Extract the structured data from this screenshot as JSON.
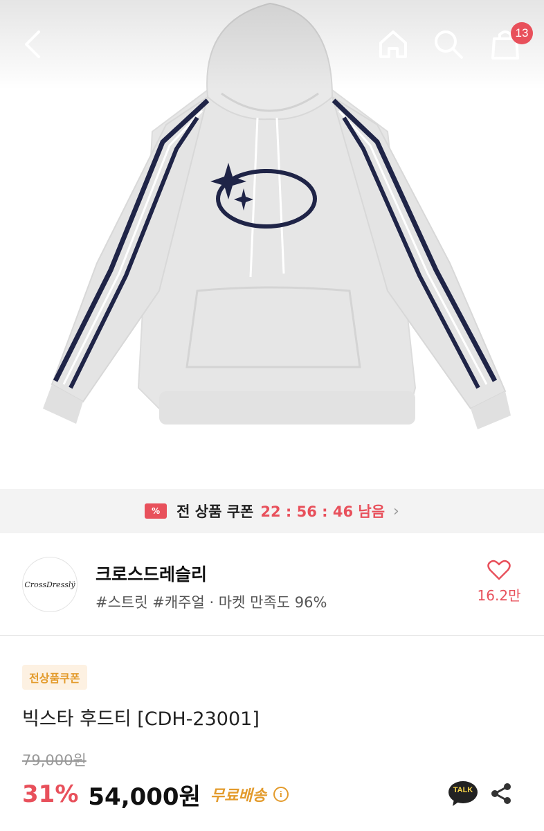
{
  "topbar": {
    "icons": [
      "back-arrow-icon",
      "home-icon",
      "search-icon",
      "shopping-bag-icon"
    ],
    "cart_count": "13"
  },
  "coupon": {
    "icon_text": "%",
    "label": "전 상품 쿠폰",
    "timer": "22 : 56 : 46 남음",
    "chevron": "›"
  },
  "shop": {
    "logo_text": "CrossDresslÿ",
    "name": "크로스드레슬리",
    "tags": "#스트릿 #캐주얼 · 마켓 만족도 96%",
    "likes": "16.2만"
  },
  "product": {
    "badge": "전상품쿠폰",
    "name": "빅스타 후드티 [CDH-23001]",
    "original_price": "79,000원",
    "discount": "31%",
    "price": "54,000원",
    "shipping": "무료배송",
    "info_icon": "i"
  },
  "actions": {
    "talk_label": "TALK"
  },
  "colors": {
    "accent": "#e8505b",
    "shipping": "#e39b2c",
    "stripe_navy": "#1f2447",
    "hoodie_gray": "#e6e6e6"
  }
}
